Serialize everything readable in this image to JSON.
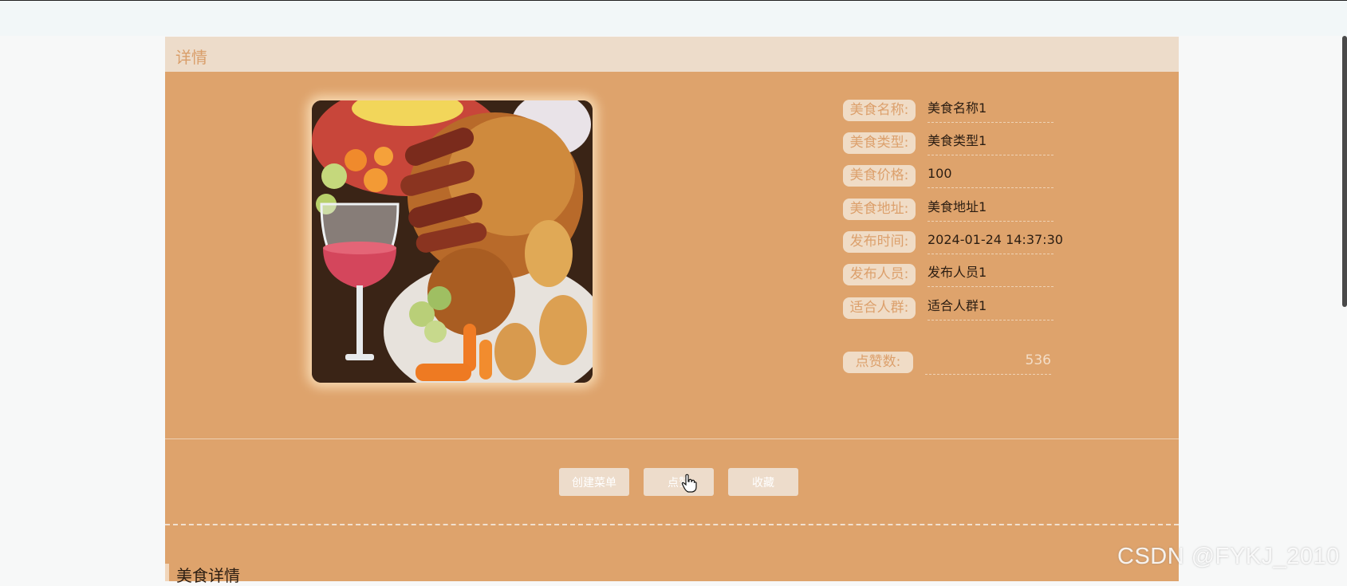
{
  "panel": {
    "title": "详情"
  },
  "food": {
    "image_alt": "food-photo",
    "fields": [
      {
        "label": "美食名称:",
        "value": "美食名称1"
      },
      {
        "label": "美食类型:",
        "value": "美食类型1"
      },
      {
        "label": "美食价格:",
        "value": "100"
      },
      {
        "label": "美食地址:",
        "value": "美食地址1"
      },
      {
        "label": "发布时间:",
        "value": "2024-01-24 14:37:30"
      },
      {
        "label": "发布人员:",
        "value": "发布人员1"
      },
      {
        "label": "适合人群:",
        "value": "适合人群1"
      }
    ],
    "likes": {
      "label": "点赞数:",
      "value": "536"
    }
  },
  "actions": {
    "create_menu": "创建菜单",
    "like": "点赞",
    "favorite": "收藏"
  },
  "detail_section": {
    "title": "美食详情"
  },
  "watermark": "CSDN @FYKJ_2010",
  "colors": {
    "panel_bg": "#dea36c",
    "header_bg": "#eddcca",
    "label_bg": "#f0dcc6",
    "button_bg": "#eddccb"
  },
  "icons": {
    "cursor": "hand-pointer-icon"
  }
}
